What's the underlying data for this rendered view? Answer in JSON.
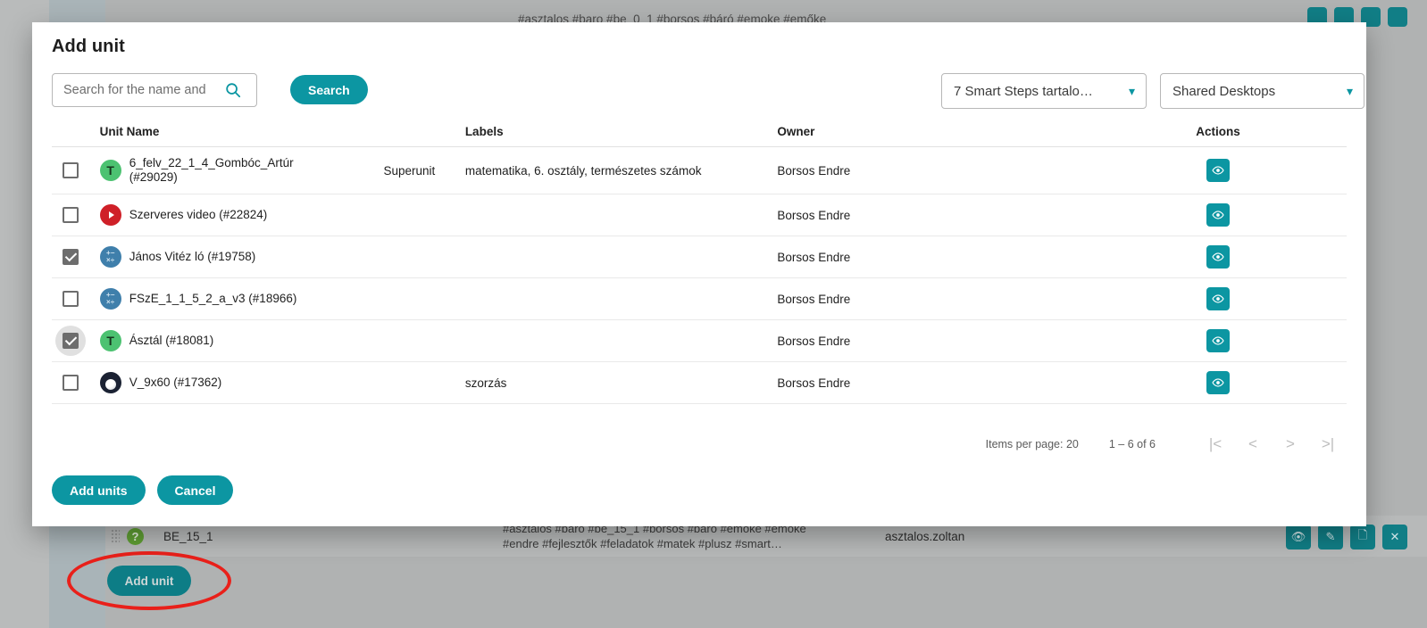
{
  "background": {
    "top_tags": "#asztalos #baro #be_0_1 #borsos #báró #emoke #emőke",
    "row": {
      "drag_handle": "drag-handle",
      "type_icon": "?",
      "name": "BE_15_1",
      "tags": "#asztalos #baro #be_15_1 #borsos #baro #emoke #emoke\n#endre #fejlesztők #feladatok #matek #plusz #smart…",
      "owner": "asztalos.zoltan",
      "actions": [
        "view",
        "edit",
        "duplicate",
        "delete"
      ]
    },
    "add_unit_label": "Add unit"
  },
  "modal": {
    "title": "Add unit",
    "search": {
      "placeholder": "Search for the name and",
      "value": "",
      "button_label": "Search"
    },
    "filters": [
      {
        "name": "content-select",
        "value": "7 Smart Steps tartalo…"
      },
      {
        "name": "desktop-select",
        "value": "Shared Desktops"
      }
    ],
    "table": {
      "headers": {
        "unit_name": "Unit Name",
        "labels": "Labels",
        "owner": "Owner",
        "actions": "Actions"
      },
      "rows": [
        {
          "checked": false,
          "focused": false,
          "icon": "text-unit-icon",
          "icon_glyph": "T",
          "name": "6_felv_22_1_4_Gombóc_Artúr\n(#29029)",
          "superunit": "Superunit",
          "labels": "matematika, 6. osztály, természetes számok",
          "owner": "Borsos Endre",
          "action": "view"
        },
        {
          "checked": false,
          "focused": false,
          "icon": "video-unit-icon",
          "icon_glyph": "",
          "name": "Szerveres video (#22824)",
          "superunit": "",
          "labels": "",
          "owner": "Borsos Endre",
          "action": "view"
        },
        {
          "checked": true,
          "focused": false,
          "icon": "math-unit-icon",
          "icon_glyph": "+−\n×÷",
          "name": "János Vitéz ló (#19758)",
          "superunit": "",
          "labels": "",
          "owner": "Borsos Endre",
          "action": "view"
        },
        {
          "checked": false,
          "focused": false,
          "icon": "math-unit-icon",
          "icon_glyph": "+−\n×÷",
          "name": "FSzE_1_1_5_2_a_v3 (#18966)",
          "superunit": "",
          "labels": "",
          "owner": "Borsos Endre",
          "action": "view"
        },
        {
          "checked": true,
          "focused": true,
          "icon": "text-unit-icon",
          "icon_glyph": "T",
          "name": "Ásztál (#18081)",
          "superunit": "",
          "labels": "",
          "owner": "Borsos Endre",
          "action": "view"
        },
        {
          "checked": false,
          "focused": false,
          "icon": "ball-unit-icon",
          "icon_glyph": "",
          "name": "V_9x60 (#17362)",
          "superunit": "",
          "labels": "szorzás",
          "owner": "Borsos Endre",
          "action": "view"
        }
      ]
    },
    "paginator": {
      "items_per_page_label": "Items per page:",
      "items_per_page_value": "20",
      "range_label": "1 – 6 of 6",
      "first_page": "|<",
      "prev_page": "<",
      "next_page": ">",
      "last_page": ">|"
    },
    "footer": {
      "add_units_label": "Add units",
      "cancel_label": "Cancel"
    }
  },
  "colors": {
    "accent": "#0c96a2",
    "accent_dark": "#0d7d86",
    "highlight": "#e9201a",
    "checkbox": "#6d6d6d"
  }
}
